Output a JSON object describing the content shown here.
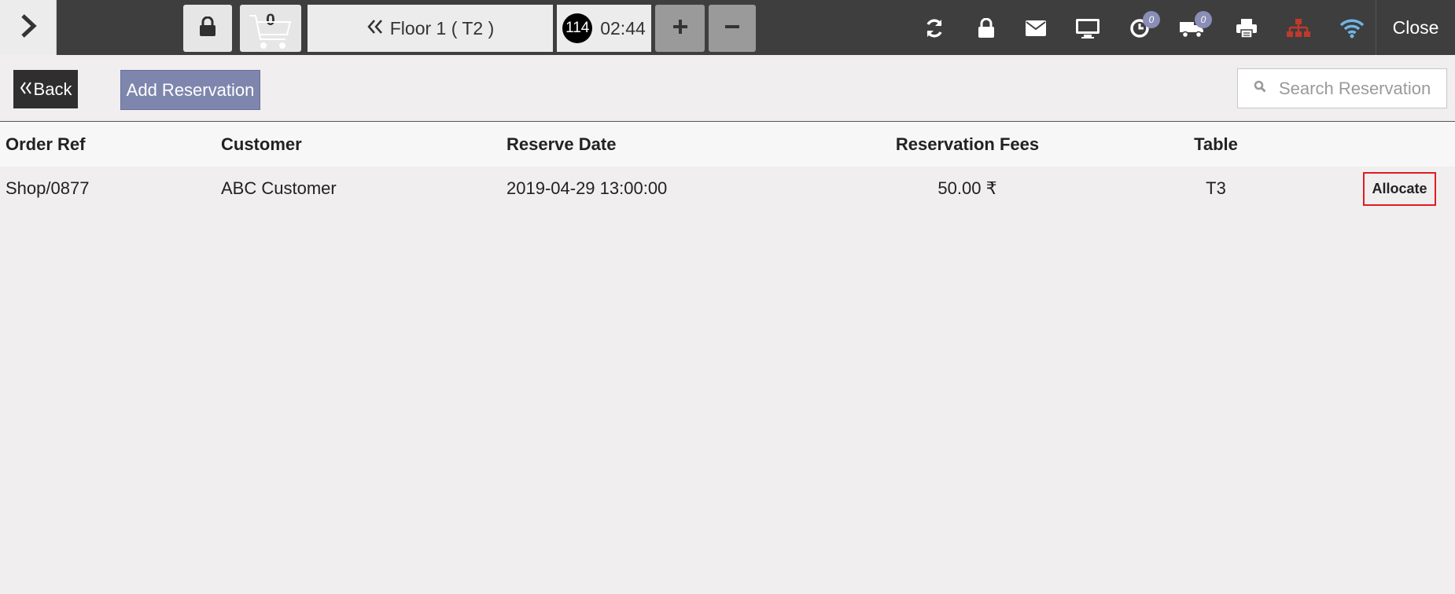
{
  "topbar": {
    "cart_count": "0",
    "floor_label": "Floor 1 ( T2 )",
    "timer_number": "114",
    "timer_time": "02:44",
    "orders_badge": "0",
    "delivery_badge": "0",
    "close_label": "Close",
    "network_icon_color": "#c0392b",
    "wifi_icon_color": "#6fb6e6"
  },
  "actions": {
    "back_label": "Back",
    "add_reservation_label": "Add Reservation",
    "search_placeholder": "Search Reservation",
    "search_value": ""
  },
  "table": {
    "headers": [
      "Order Ref",
      "Customer",
      "Reserve Date",
      "Reservation Fees",
      "Table"
    ],
    "rows": [
      {
        "order_ref": "Shop/0877",
        "customer": "ABC Customer",
        "reserve_date": "2019-04-29 13:00:00",
        "fees": "50.00 ₹",
        "table": "T3",
        "action_label": "Allocate"
      }
    ]
  },
  "colors": {
    "accent": "#7f86ad",
    "highlight_border": "#e01b24"
  }
}
